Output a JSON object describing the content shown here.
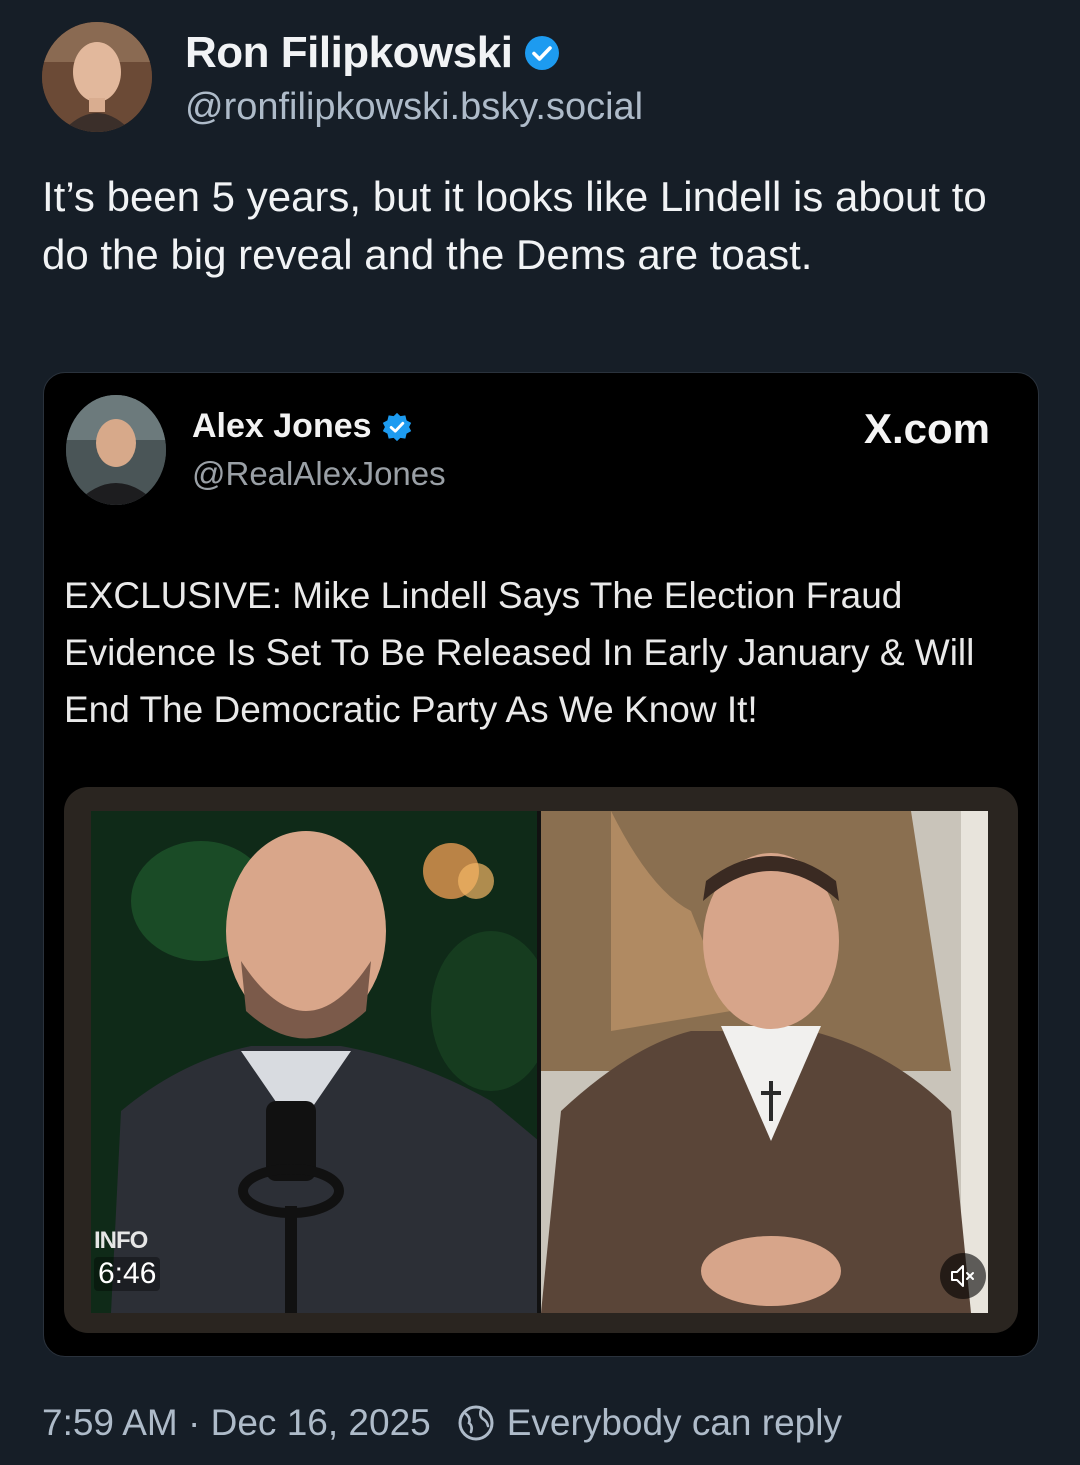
{
  "post": {
    "author_name": "Ron Filipkowski",
    "author_handle": "@ronfilipkowski.bsky.social",
    "text": "It’s been 5 years, but it looks like Lindell is about to do the big reveal and the Dems are toast.",
    "timestamp": "7:59 AM · Dec 16, 2025",
    "reply_setting": "Everybody can reply"
  },
  "embed": {
    "author_name": "Alex Jones",
    "author_handle": "@RealAlexJones",
    "source": "X.com",
    "text": "EXCLUSIVE: Mike Lindell Says The Election Fraud Evidence Is Set To Be Released In Early January & Will End The Democratic Party As We Know It!",
    "video": {
      "logo": "INFO",
      "duration": "6:46"
    }
  },
  "icons": {
    "verified": "verified-check-icon",
    "globe": "globe-icon",
    "mute": "muted-speaker-icon"
  },
  "colors": {
    "background": "#161e27",
    "verified_badge": "#1d9bf0",
    "secondary_text": "#aebbc9"
  }
}
